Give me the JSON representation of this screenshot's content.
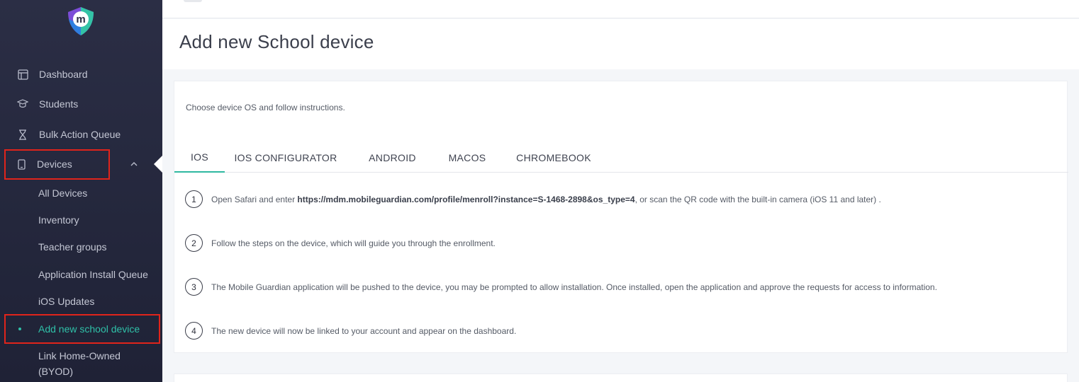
{
  "sidebar": {
    "nav": [
      {
        "label": "Dashboard",
        "icon": "dashboard-icon"
      },
      {
        "label": "Students",
        "icon": "graduation-cap-icon"
      },
      {
        "label": "Bulk Action Queue",
        "icon": "hourglass-icon"
      },
      {
        "label": "Devices",
        "icon": "device-icon",
        "expanded": true
      }
    ],
    "devices_submenu": [
      {
        "label": "All Devices"
      },
      {
        "label": "Inventory"
      },
      {
        "label": "Teacher groups"
      },
      {
        "label": "Application Install Queue"
      },
      {
        "label": "iOS Updates"
      },
      {
        "label": "Add new school device",
        "active": true
      },
      {
        "label": "Link Home-Owned (BYOD)"
      }
    ]
  },
  "header": {
    "title": "Add new School device"
  },
  "main": {
    "intro": "Choose device OS and follow instructions.",
    "tabs": [
      {
        "label": "IOS",
        "active": true
      },
      {
        "label": "IOS CONFIGURATOR"
      },
      {
        "label": "ANDROID"
      },
      {
        "label": "MACOS"
      },
      {
        "label": "CHROMEBOOK"
      }
    ],
    "steps": [
      {
        "num": "1",
        "pre": "Open Safari and enter ",
        "bold": "https://mdm.mobileguardian.com/profile/menroll?instance=S-1468-2898&os_type=4",
        "post": ", or scan the QR code with the built-in camera (iOS 11 and later) ."
      },
      {
        "num": "2",
        "text": "Follow the steps on the device, which will guide you through the enrollment."
      },
      {
        "num": "3",
        "text": "The Mobile Guardian application will be pushed to the device, you may be prompted to allow installation. Once installed, open the application and approve the requests for access to information."
      },
      {
        "num": "4",
        "text": "The new device will now be linked to your account and appear on the dashboard."
      }
    ]
  },
  "colors": {
    "accent": "#2fc1a8",
    "highlight_box": "#e0241b",
    "sidebar_bg": "#262940"
  }
}
